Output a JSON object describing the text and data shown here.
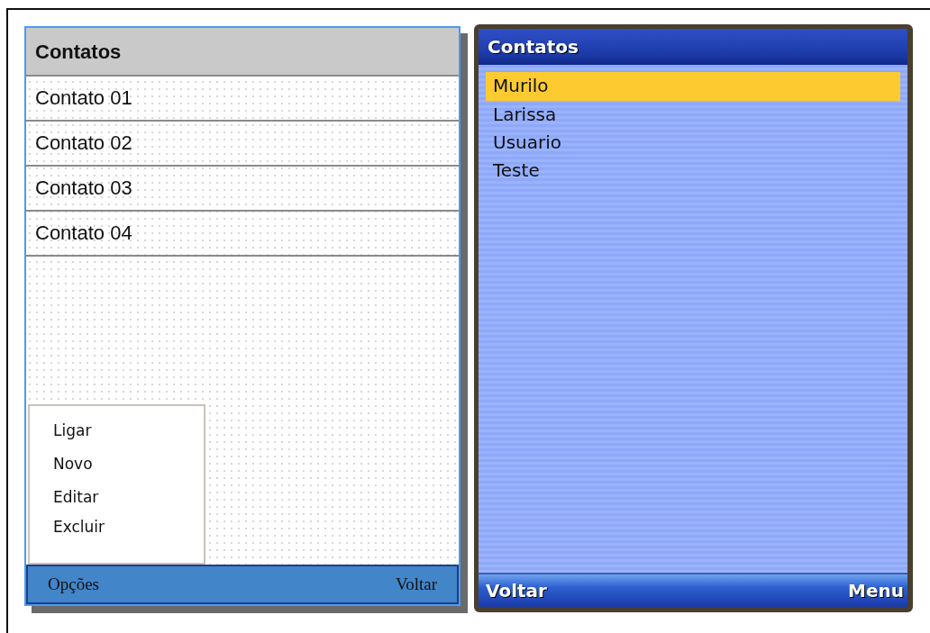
{
  "mockup": {
    "title": "Contatos",
    "contacts": [
      {
        "name": "Contato 01"
      },
      {
        "name": "Contato 02"
      },
      {
        "name": "Contato 03"
      },
      {
        "name": "Contato 04"
      }
    ],
    "menu": {
      "items": [
        "Ligar",
        "Novo",
        "Editar",
        "Excluir"
      ]
    },
    "softkeys": {
      "left": "Opções",
      "right": "Voltar"
    }
  },
  "phone": {
    "title": "Contatos",
    "contacts": [
      {
        "name": "Murilo",
        "selected": true
      },
      {
        "name": "Larissa",
        "selected": false
      },
      {
        "name": "Usuario",
        "selected": false
      },
      {
        "name": "Teste",
        "selected": false
      }
    ],
    "softkeys": {
      "left": "Voltar",
      "right": "Menu"
    }
  }
}
